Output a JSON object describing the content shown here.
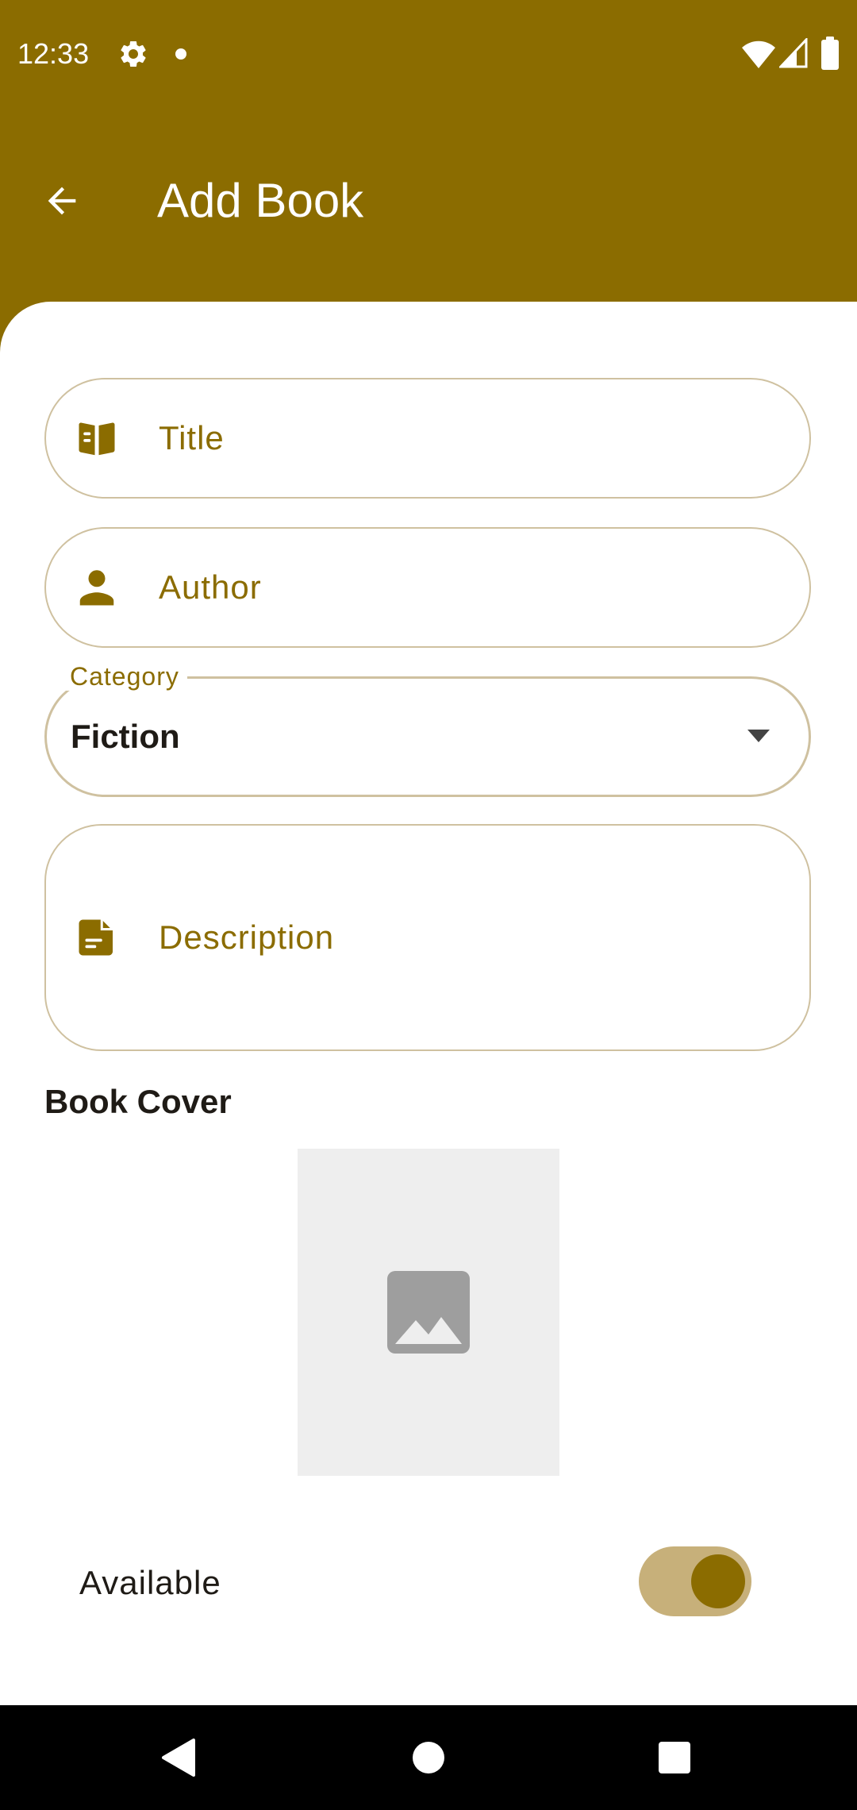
{
  "status_bar": {
    "time": "12:33",
    "left_icons": [
      "settings-icon",
      "notification-dot-icon"
    ],
    "right_icons": [
      "wifi-icon",
      "cellular-signal-icon",
      "battery-icon"
    ]
  },
  "app_bar": {
    "title": "Add Book",
    "back_icon": "arrow-back-icon"
  },
  "form": {
    "title_field": {
      "placeholder": "Title",
      "value": "",
      "icon": "book-icon"
    },
    "author_field": {
      "placeholder": "Author",
      "value": "",
      "icon": "person-icon"
    },
    "category_field": {
      "label": "Category",
      "value": "Fiction",
      "icon": "dropdown-arrow-icon"
    },
    "description_field": {
      "placeholder": "Description",
      "value": "",
      "icon": "description-icon"
    },
    "cover_heading": "Book Cover",
    "cover_placeholder_icon": "image-icon",
    "available": {
      "label": "Available",
      "checked": true
    }
  },
  "nav_bar": {
    "buttons": [
      "back-triangle-icon",
      "home-circle-icon",
      "recents-square-icon"
    ]
  },
  "colors": {
    "primary": "#8B6C00",
    "outline": "#CFC1A0",
    "switch_track": "#C7B07A",
    "surface": "#FFFFFF",
    "cover_placeholder": "#EEEEEE"
  }
}
